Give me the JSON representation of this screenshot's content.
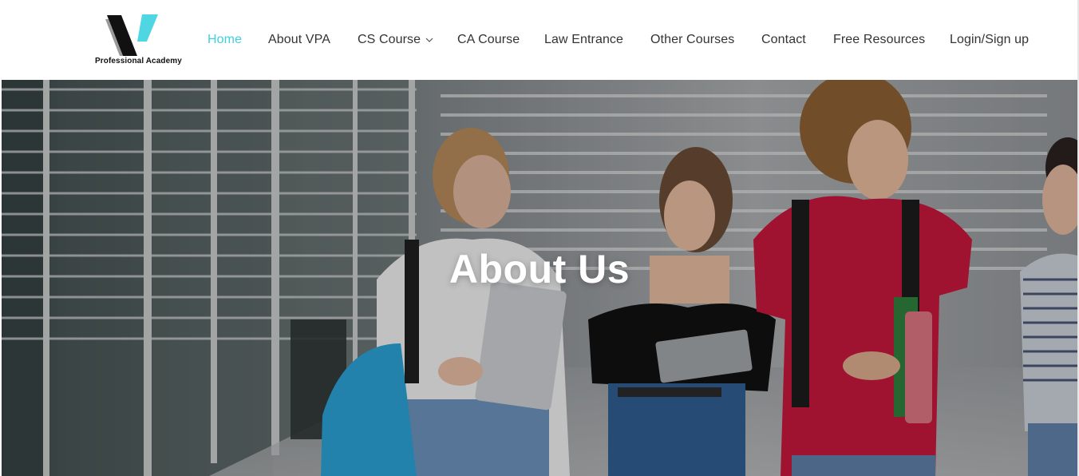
{
  "brand": {
    "logo_text": "Professional Academy",
    "colors": {
      "mark_dark": "#111111",
      "mark_accent": "#4fd6e3"
    }
  },
  "nav": {
    "items": [
      {
        "label": "Home",
        "active": true
      },
      {
        "label": "About VPA",
        "active": false
      },
      {
        "label": "CS Course",
        "active": false,
        "has_dropdown": true
      },
      {
        "label": "CA Course",
        "active": false
      },
      {
        "label": "Law Entrance",
        "active": false
      },
      {
        "label": "Other Courses",
        "active": false
      },
      {
        "label": "Contact",
        "active": false
      },
      {
        "label": "Free Resources",
        "active": false
      },
      {
        "label": "Login/Sign up",
        "active": false
      }
    ],
    "active_color": "#3fd0dd",
    "text_color": "#333333"
  },
  "hero": {
    "title": "About Us",
    "image_description_icon": "students-photo"
  }
}
